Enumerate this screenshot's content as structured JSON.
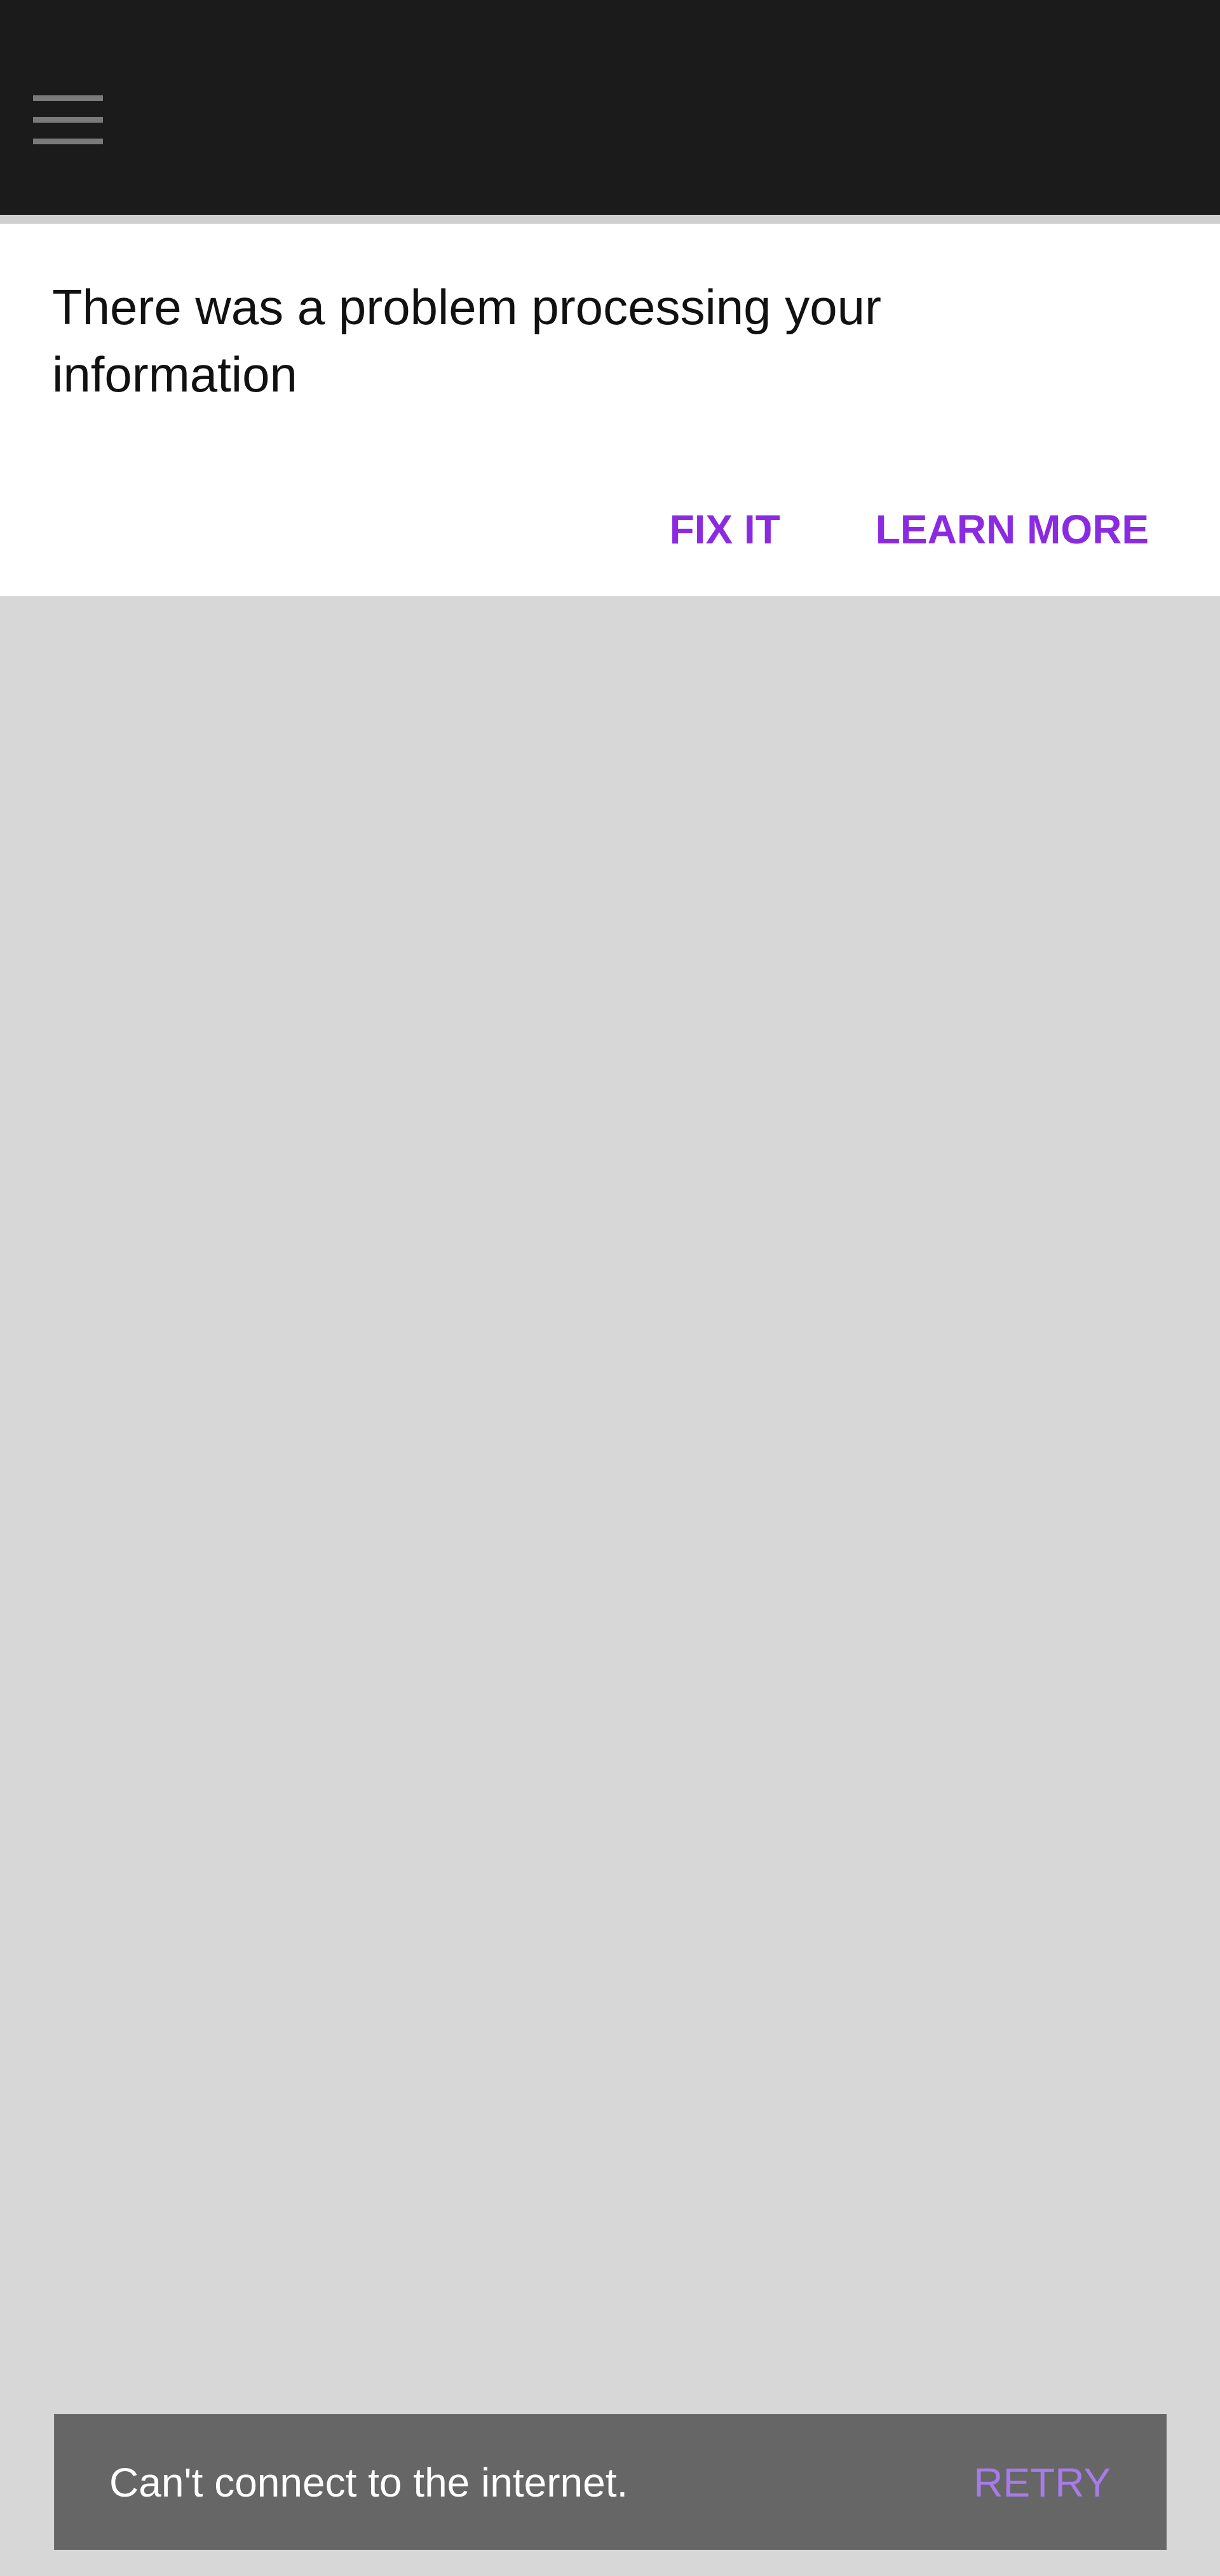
{
  "header": {
    "menu_icon": "hamburger-menu-icon",
    "background_color": "#1b1b1b"
  },
  "notice": {
    "message": "There was a problem processing your information",
    "actions": [
      {
        "label": "FIX IT"
      },
      {
        "label": "LEARN MORE"
      }
    ],
    "accent_color": "#8a2be2"
  },
  "snackbar": {
    "message": "Can't connect to the internet.",
    "action_label": "RETRY",
    "background_color": "#666666",
    "action_color": "#a77be8"
  }
}
